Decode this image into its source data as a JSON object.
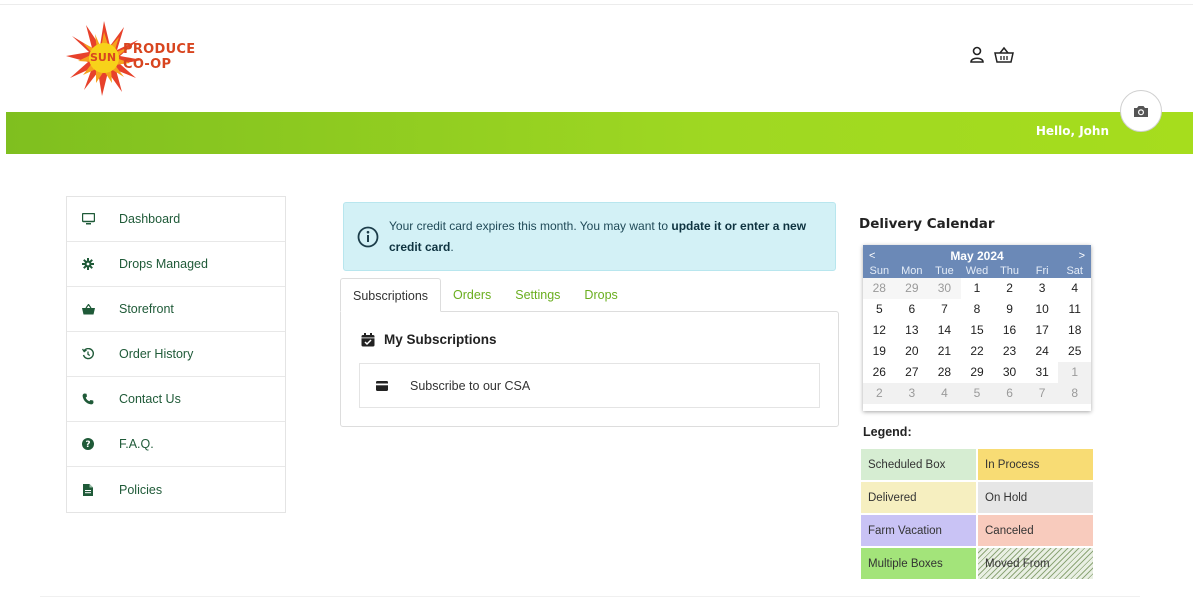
{
  "header": {
    "logo": {
      "badge": "SUN",
      "line1": "PRODUCE",
      "line2": "CO-OP"
    },
    "greeting": "Hello, John",
    "icons": {
      "account": "user-icon",
      "cart": "basket-icon",
      "camera": "camera-icon"
    }
  },
  "sidebar": {
    "items": [
      {
        "label": "Dashboard",
        "icon": "desktop-icon"
      },
      {
        "label": "Drops Managed",
        "icon": "gear-icon"
      },
      {
        "label": "Storefront",
        "icon": "basket-icon"
      },
      {
        "label": "Order History",
        "icon": "history-icon"
      },
      {
        "label": "Contact Us",
        "icon": "phone-icon"
      },
      {
        "label": "F.A.Q.",
        "icon": "question-icon"
      },
      {
        "label": "Policies",
        "icon": "file-icon"
      }
    ]
  },
  "alert": {
    "text": "Your credit card expires this month. You may want to ",
    "link": "update it or enter a new credit card",
    "suffix": "."
  },
  "tabs": [
    {
      "label": "Subscriptions",
      "active": true
    },
    {
      "label": "Orders",
      "active": false
    },
    {
      "label": "Settings",
      "active": false
    },
    {
      "label": "Drops",
      "active": false
    }
  ],
  "subscriptions": {
    "title": "My Subscriptions",
    "item": "Subscribe to our CSA"
  },
  "calendar": {
    "title": "Delivery Calendar",
    "month": "May 2024",
    "prev": "<",
    "next": ">",
    "weekdays": [
      "Sun",
      "Mon",
      "Tue",
      "Wed",
      "Thu",
      "Fri",
      "Sat"
    ],
    "days": [
      {
        "d": "28",
        "o": "pre"
      },
      {
        "d": "29",
        "o": "pre"
      },
      {
        "d": "30",
        "o": "pre"
      },
      {
        "d": "1"
      },
      {
        "d": "2"
      },
      {
        "d": "3"
      },
      {
        "d": "4"
      },
      {
        "d": "5"
      },
      {
        "d": "6"
      },
      {
        "d": "7"
      },
      {
        "d": "8"
      },
      {
        "d": "9"
      },
      {
        "d": "10"
      },
      {
        "d": "11"
      },
      {
        "d": "12"
      },
      {
        "d": "13"
      },
      {
        "d": "14"
      },
      {
        "d": "15"
      },
      {
        "d": "16"
      },
      {
        "d": "17"
      },
      {
        "d": "18"
      },
      {
        "d": "19"
      },
      {
        "d": "20"
      },
      {
        "d": "21"
      },
      {
        "d": "22"
      },
      {
        "d": "23"
      },
      {
        "d": "24"
      },
      {
        "d": "25"
      },
      {
        "d": "26"
      },
      {
        "d": "27"
      },
      {
        "d": "28"
      },
      {
        "d": "29"
      },
      {
        "d": "30"
      },
      {
        "d": "31"
      },
      {
        "d": "1",
        "o": "post"
      },
      {
        "d": "2",
        "o": "post"
      },
      {
        "d": "3",
        "o": "post"
      },
      {
        "d": "4",
        "o": "post"
      },
      {
        "d": "5",
        "o": "post"
      },
      {
        "d": "6",
        "o": "post"
      },
      {
        "d": "7",
        "o": "post"
      },
      {
        "d": "8",
        "o": "post"
      }
    ],
    "legend_title": "Legend:",
    "legend": [
      {
        "label": "Scheduled Box",
        "color": "#d6edd2"
      },
      {
        "label": "In Process",
        "color": "#f8dc74"
      },
      {
        "label": "Delivered",
        "color": "#f6efc0"
      },
      {
        "label": "On Hold",
        "color": "#e6e6e6"
      },
      {
        "label": "Farm Vacation",
        "color": "#c9c3f5"
      },
      {
        "label": "Canceled",
        "color": "#f8cbbd"
      },
      {
        "label": "Multiple Boxes",
        "color": "#a3e47a"
      },
      {
        "label": "Moved From",
        "color": "hatch"
      }
    ]
  }
}
